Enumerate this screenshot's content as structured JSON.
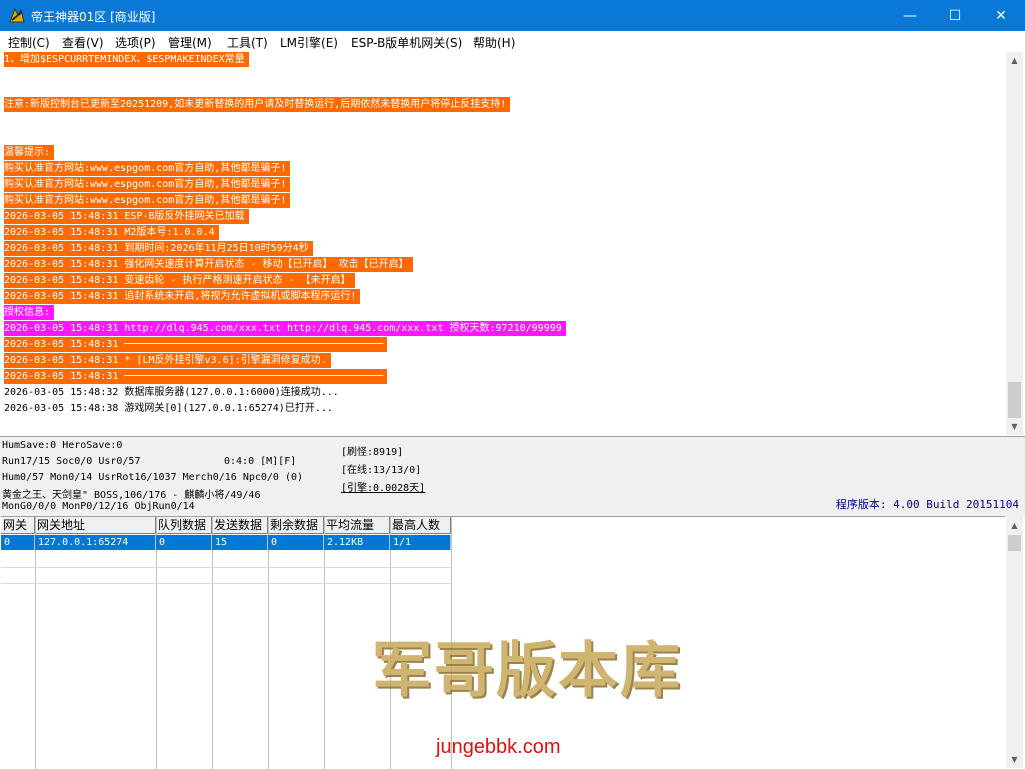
{
  "window": {
    "title": "帝王神器01区 [商业版]",
    "min_glyph": "—",
    "max_glyph": "☐",
    "close_glyph": "✕"
  },
  "menu": [
    "控制(C)",
    "查看(V)",
    "选项(P)",
    "管理(M)",
    "工具(T)",
    "LM引擎(E)",
    "ESP-B版单机网关(S)",
    "帮助(H)"
  ],
  "log": [
    {
      "text": "1、增加$ESPCURRTEMINDEX、$ESPMAKEINDEX常量",
      "style": "orange"
    },
    {
      "text": "注意:新版控制台已更新至20251209,如未更新替换的用户请及时替换运行,后期依然未替换用户将停止反挂支持!",
      "style": "orange"
    },
    {
      "text": "温馨提示:",
      "style": "orange"
    },
    {
      "text": "购买认准官方网站:www.espgom.com官方自助,其他都是骗子!",
      "style": "orange"
    },
    {
      "text": "购买认准官方网站:www.espgom.com官方自助,其他都是骗子!",
      "style": "orange"
    },
    {
      "text": "购买认准官方网站:www.espgom.com官方自助,其他都是骗子!",
      "style": "orange"
    },
    {
      "text": "2026-03-05 15:48:31 ESP-B版反外挂网关已加载",
      "style": "orange"
    },
    {
      "text": "2026-03-05 15:48:31 M2版本号:1.0.0.4",
      "style": "orange"
    },
    {
      "text": "2026-03-05 15:48:31 到期时间:2026年11月25日10时59分4秒",
      "style": "orange"
    },
    {
      "text": "2026-03-05 15:48:31 强化网关速度计算开启状态 - 移动【已开启】 攻击【已开启】",
      "style": "orange"
    },
    {
      "text": "2026-03-05 15:48:31 变速齿轮 - 执行严格测速开启状态 - 【未开启】",
      "style": "orange"
    },
    {
      "text": "2026-03-05 15:48:31 追封系统未开启,将视为允许虚拟机或脚本程序运行!",
      "style": "orange"
    },
    {
      "text": "授权信息:",
      "style": "magenta"
    },
    {
      "text": "2026-03-05 15:48:31 http://dlq.945.com/xxx.txt http://dlq.945.com/xxx.txt 授权天数:97210/99999",
      "style": "magenta"
    },
    {
      "text": "2026-03-05 15:48:31 ───────────────────────────────────────────",
      "style": "orange"
    },
    {
      "text": "2026-03-05 15:48:31 * [LM反外挂引擎v3.6]:引擎漏洞修复成功.",
      "style": "orange"
    },
    {
      "text": "2026-03-05 15:48:31 ───────────────────────────────────────────",
      "style": "orange"
    },
    {
      "text": "2026-03-05 15:48:32 数据库服务器(127.0.0.1:6000)连接成功...",
      "style": "plain"
    },
    {
      "text": "2026-03-05 15:48:38 游戏网关[0](127.0.0.1:65274)已打开...",
      "style": "plain"
    }
  ],
  "status": {
    "line1": "HumSave:0 HeroSave:0",
    "line2a": "Run17/15 Soc0/0 Usr0/57",
    "line2b": "0:4:0 [M][F]",
    "line3": "Hum0/57 Mon0/14 UsrRot16/1037 Merch0/16 Npc0/0 (0)",
    "line4": "黄金之王、天剑皇\" BOSS,106/176 - 麒麟小将/49/46",
    "line5": "MonG0/0/0 MonP0/12/16 ObjRun0/14",
    "refresh": "[刷怪:8919]",
    "online": "[在线:13/13/0]",
    "engine": "[引擎:0.0028天]",
    "version": "程序版本: 4.00 Build 20151104"
  },
  "table": {
    "headers": [
      "网关",
      "网关地址",
      "队列数据",
      "发送数据",
      "剩余数据",
      "平均流量",
      "最高人数"
    ],
    "rows": [
      [
        "0",
        "127.0.0.1:65274",
        "0",
        "15",
        "0",
        "2.12KB",
        "1/1"
      ]
    ]
  },
  "watermark": {
    "logo": "军哥版本库",
    "url": "jungebbk.com"
  },
  "colors": {
    "accent": "#0a78d7",
    "log_orange": "#ff6a00",
    "log_magenta": "#ff18ff",
    "selection": "#0078d7"
  }
}
